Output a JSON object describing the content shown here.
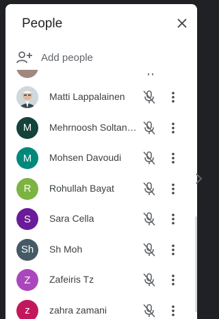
{
  "panel": {
    "title": "People",
    "close_icon": "close-icon",
    "add_people_label": "Add people",
    "add_people_icon": "person-add-icon"
  },
  "participants": [
    {
      "name": "Matti Lappalainen",
      "initial": "",
      "avatar_type": "photo",
      "color": "#d9d9d9",
      "mic": "mic-off-icon",
      "menu": "more-vert-icon"
    },
    {
      "name": "Mehrnoosh Soltani...",
      "initial": "M",
      "avatar_type": "letter",
      "color": "#16423c",
      "mic": "mic-off-icon",
      "menu": "more-vert-icon"
    },
    {
      "name": "Mohsen Davoudi",
      "initial": "M",
      "avatar_type": "letter",
      "color": "#00897b",
      "mic": "mic-off-icon",
      "menu": "more-vert-icon"
    },
    {
      "name": "Rohullah Bayat",
      "initial": "R",
      "avatar_type": "letter",
      "color": "#7cb342",
      "mic": "mic-off-icon",
      "menu": "more-vert-icon"
    },
    {
      "name": "Sara Cella",
      "initial": "S",
      "avatar_type": "letter",
      "color": "#6a1b9a",
      "mic": "mic-off-icon",
      "menu": "more-vert-icon"
    },
    {
      "name": "Sh Moh",
      "initial": "Sh",
      "avatar_type": "letter",
      "color": "#455a64",
      "mic": "mic-off-icon",
      "menu": "more-vert-icon"
    },
    {
      "name": "Zafeiris Tz",
      "initial": "Z",
      "avatar_type": "letter",
      "color": "#ab47bc",
      "mic": "mic-off-icon",
      "menu": "more-vert-icon"
    },
    {
      "name": "zahra zamani",
      "initial": "z",
      "avatar_type": "letter",
      "color": "#c2185b",
      "mic": "mic-off-icon",
      "menu": "more-vert-icon"
    }
  ]
}
